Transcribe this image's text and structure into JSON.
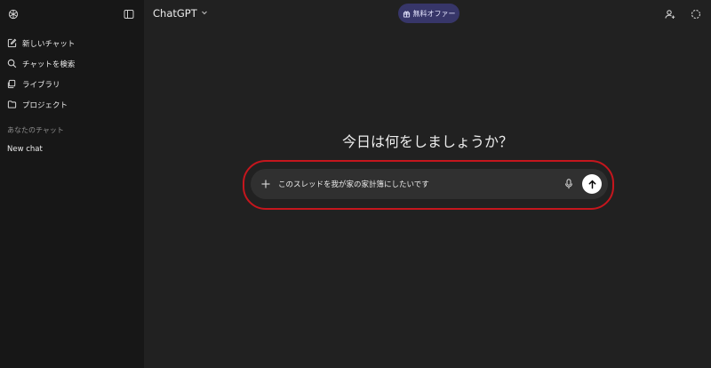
{
  "sidebar": {
    "items": [
      {
        "label": "新しいチャット",
        "icon": "new-chat-icon"
      },
      {
        "label": "チャットを検索",
        "icon": "search-icon"
      },
      {
        "label": "ライブラリ",
        "icon": "library-icon"
      },
      {
        "label": "プロジェクト",
        "icon": "project-folder-icon"
      }
    ],
    "section_title": "あなたのチャット",
    "chats": [
      "New chat"
    ]
  },
  "header": {
    "model": "ChatGPT",
    "offer": "無料オファー"
  },
  "main": {
    "headline": "今日は何をしましょうか？",
    "composer_value": "このスレッドを我が家の家計簿にしたいです"
  },
  "colors": {
    "background": "#212121",
    "sidebar": "#171717",
    "offer_badge": "#373669",
    "annotation": "#c5161d"
  }
}
